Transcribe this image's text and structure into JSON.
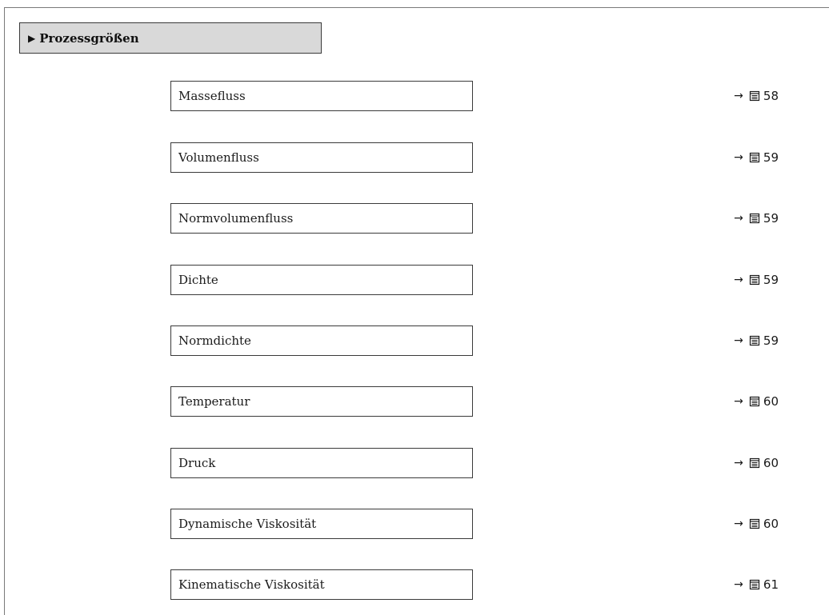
{
  "section": {
    "marker": "▶",
    "title": "Prozessgrößen"
  },
  "parameters": [
    {
      "label": "Massefluss",
      "arrow": "→",
      "page": "58"
    },
    {
      "label": "Volumenfluss",
      "arrow": "→",
      "page": "59"
    },
    {
      "label": "Normvolumenfluss",
      "arrow": "→",
      "page": "59"
    },
    {
      "label": "Dichte",
      "arrow": "→",
      "page": "59"
    },
    {
      "label": "Normdichte",
      "arrow": "→",
      "page": "59"
    },
    {
      "label": "Temperatur",
      "arrow": "→",
      "page": "60"
    },
    {
      "label": "Druck",
      "arrow": "→",
      "page": "60"
    },
    {
      "label": "Dynamische Viskosität",
      "arrow": "→",
      "page": "60"
    },
    {
      "label": "Kinematische Viskosität",
      "arrow": "→",
      "page": "61"
    }
  ],
  "icons": {
    "reference": "book-page-icon"
  }
}
